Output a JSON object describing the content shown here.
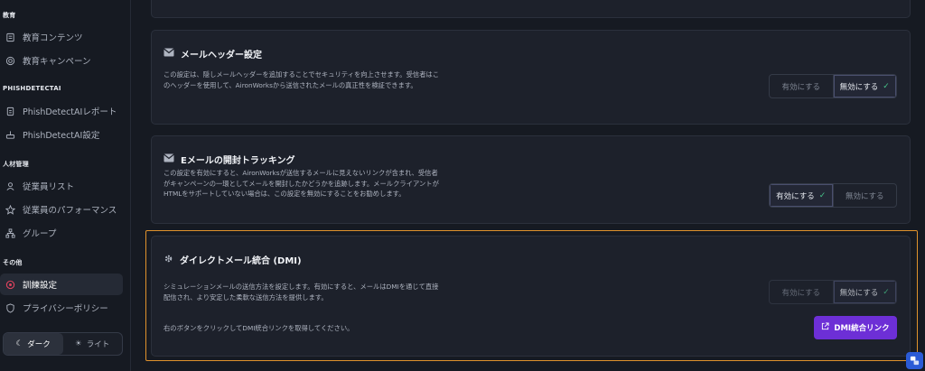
{
  "sidebar": {
    "sections": [
      {
        "title": "教育",
        "items": [
          {
            "label": "教育コンテンツ",
            "icon": "book-icon"
          },
          {
            "label": "教育キャンペーン",
            "icon": "target-icon"
          }
        ]
      },
      {
        "title": "PHISHDETECTAI",
        "items": [
          {
            "label": "PhishDetectAIレポート",
            "icon": "report-icon"
          },
          {
            "label": "PhishDetectAI設定",
            "icon": "settings-icon"
          }
        ]
      },
      {
        "title": "人材管理",
        "items": [
          {
            "label": "従業員リスト",
            "icon": "user-icon"
          },
          {
            "label": "従業員のパフォーマンス",
            "icon": "star-icon"
          },
          {
            "label": "グループ",
            "icon": "group-icon"
          }
        ]
      },
      {
        "title": "その他",
        "items": [
          {
            "label": "訓練設定",
            "icon": "gear-icon",
            "active": true
          },
          {
            "label": "プライバシーポリシー",
            "icon": "shield-icon"
          }
        ]
      }
    ],
    "theme": {
      "dark": "ダーク",
      "light": "ライト"
    }
  },
  "cards": {
    "mail_header": {
      "title": "メールヘッダー設定",
      "desc": "この設定は、隠しメールヘッダーを追加することでセキュリティを向上させます。受信者はこのヘッダーを使用して、AironWorksから送信されたメールの真正性を検証できます。",
      "enable": "有効にする",
      "disable": "無効にする",
      "selected": "disable"
    },
    "open_tracking": {
      "title": "Eメールの開封トラッキング",
      "desc": "この設定を有効にすると、AironWorksが送信するメールに見えないリンクが含まれ、受信者がキャンペーンの一環としてメールを開封したかどうかを追跡します。メールクライアントがHTMLをサポートしていない場合は、この設定を無効にすることをお勧めします。",
      "enable": "有効にする",
      "disable": "無効にする",
      "selected": "enable"
    },
    "dmi": {
      "title": "ダイレクトメール統合 (DMI)",
      "desc": "シミュレーションメールの送信方法を設定します。有効にすると、メールはDMIを通じて直接配信され、より安定した柔軟な送信方法を提供します。",
      "enable": "有効にする",
      "disable": "無効にする",
      "selected": "disable",
      "link_hint": "右のボタンをクリックしてDMI統合リンクを取得してください。",
      "link_button": "DMI統合リンク"
    }
  },
  "colors": {
    "accent": "#6d2fd6",
    "highlight": "#e0922c",
    "check": "#46c38a"
  }
}
